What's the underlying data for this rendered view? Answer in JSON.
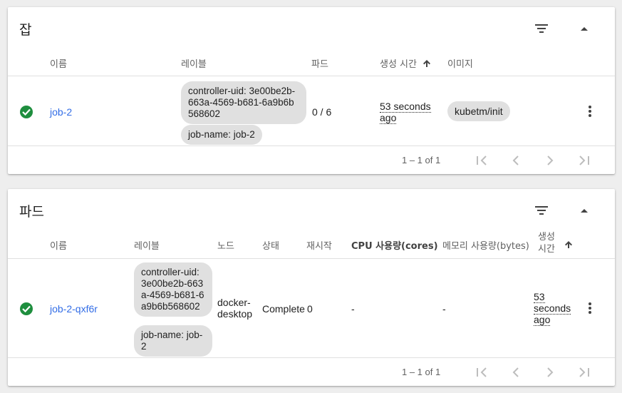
{
  "jobs": {
    "title": "잡",
    "columns": {
      "name": "이름",
      "labels": "레이블",
      "pods": "파드",
      "created": "생성 시간",
      "images": "이미지"
    },
    "row": {
      "name": "job-2",
      "label1": "controller-uid: 3e00be2b-663a-4569-b681-6a9b6b568602",
      "label2": "job-name: job-2",
      "pods": "0 / 6",
      "created": "53 seconds ago",
      "image": "kubetm/init"
    },
    "pager": "1 – 1 of 1"
  },
  "pods": {
    "title": "파드",
    "columns": {
      "name": "이름",
      "labels": "레이블",
      "node": "노드",
      "status": "상태",
      "restarts": "재시작",
      "cpu": "CPU 사용량(cores)",
      "memory": "메모리 사용량(bytes)",
      "created": "생성 시간"
    },
    "row": {
      "name": "job-2-qxf6r",
      "label1": "controller-uid: 3e00be2b-663a-4569-b681-6a9b6b568602",
      "label2": "job-name: job-2",
      "node": "docker-desktop",
      "status": "Complete",
      "restarts": "0",
      "cpu": "-",
      "memory": "-",
      "created": "53 seconds ago"
    },
    "pager": "1 – 1 of 1"
  },
  "icons": {
    "filter": "filter-icon",
    "collapse": "arrow-up-icon",
    "sort": "arrow-upward-icon",
    "status": "check-circle-icon",
    "menu": "more-vert-icon",
    "first": "first-page-icon",
    "prev": "chevron-left-icon",
    "next": "chevron-right-icon",
    "last": "last-page-icon"
  },
  "colors": {
    "link": "#326de6",
    "success": "#1e8e3e",
    "chip": "#e0e0e0"
  }
}
